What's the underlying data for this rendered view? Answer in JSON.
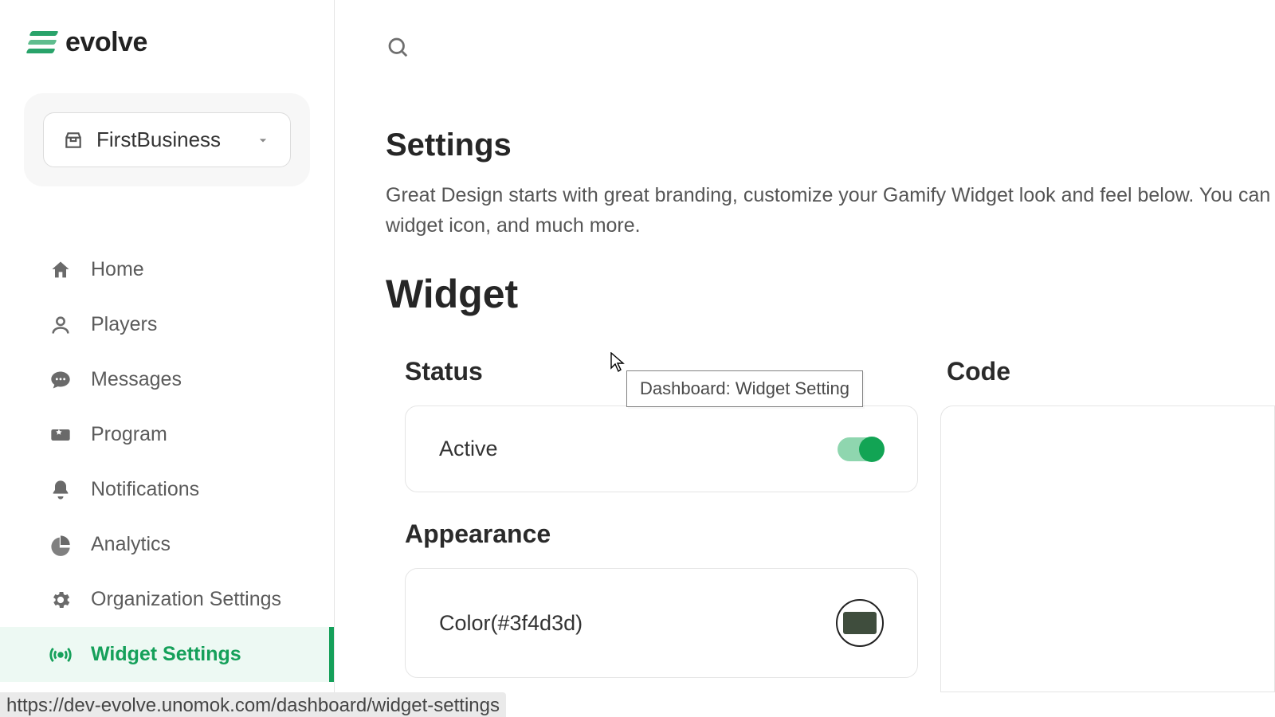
{
  "brand": {
    "name": "evolve"
  },
  "org": {
    "selected": "FirstBusiness"
  },
  "nav": {
    "items": [
      {
        "label": "Home"
      },
      {
        "label": "Players"
      },
      {
        "label": "Messages"
      },
      {
        "label": "Program"
      },
      {
        "label": "Notifications"
      },
      {
        "label": "Analytics"
      },
      {
        "label": "Organization Settings"
      },
      {
        "label": "Widget Settings"
      }
    ]
  },
  "page": {
    "title": "Settings",
    "description": "Great Design starts with great branding, customize your Gamify Widget look and feel below. You can widget icon, and much more.",
    "section": "Widget"
  },
  "status": {
    "heading": "Status",
    "active_label": "Active",
    "active": true
  },
  "appearance": {
    "heading": "Appearance",
    "color_label": "Color(#3f4d3d)",
    "color_hex": "#3f4d3d"
  },
  "code": {
    "heading": "Code"
  },
  "tooltip": {
    "text": "Dashboard: Widget Setting"
  },
  "statusbar": {
    "url": "https://dev-evolve.unomok.com/dashboard/widget-settings"
  },
  "colors": {
    "accent": "#15a05a"
  }
}
